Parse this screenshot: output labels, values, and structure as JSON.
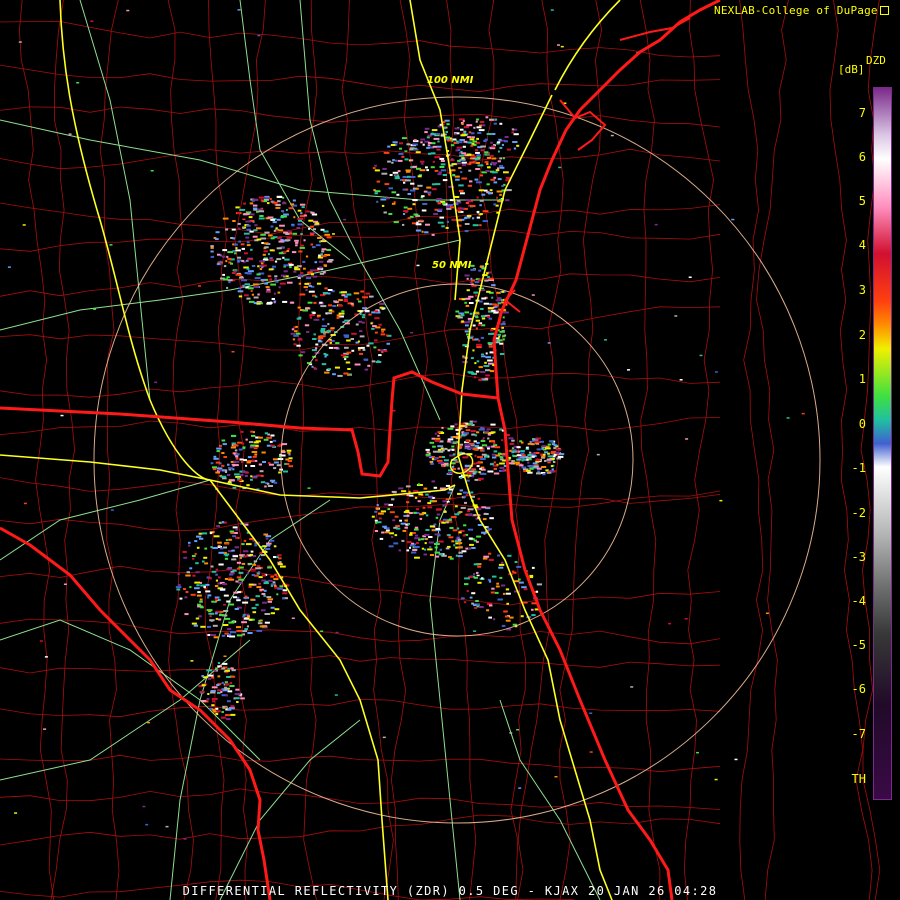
{
  "header": {
    "credit": "NEXLAB-College of DuPage"
  },
  "legend": {
    "product": "DZD",
    "unit": "[dB]",
    "ticks": [
      "7",
      "6",
      "5",
      "4",
      "3",
      "2",
      "1",
      "0",
      "-1",
      "-2",
      "-3",
      "-4",
      "-5",
      "-6",
      "-7",
      "TH"
    ],
    "gradient_stops": [
      {
        "value": 7.5,
        "color": "#7a2a8a"
      },
      {
        "value": 6.5,
        "color": "#dcc8e6"
      },
      {
        "value": 6.0,
        "color": "#ffffff"
      },
      {
        "value": 5.0,
        "color": "#ff8fbf"
      },
      {
        "value": 4.0,
        "color": "#d01030"
      },
      {
        "value": 3.0,
        "color": "#ff4010"
      },
      {
        "value": 2.5,
        "color": "#ff8c00"
      },
      {
        "value": 2.0,
        "color": "#f0f000"
      },
      {
        "value": 1.0,
        "color": "#40e040"
      },
      {
        "value": 0.5,
        "color": "#20c0a0"
      },
      {
        "value": 0.0,
        "color": "#4060d0"
      },
      {
        "value": -0.5,
        "color": "#ffffff"
      },
      {
        "value": -2.0,
        "color": "#b0b0b0"
      },
      {
        "value": -3.0,
        "color": "#707070"
      },
      {
        "value": -4.0,
        "color": "#383838"
      },
      {
        "value": -5.5,
        "color": "#200a28"
      },
      {
        "value": -7.5,
        "color": "#3a0a46"
      }
    ]
  },
  "map": {
    "range_rings": [
      {
        "label": "100 NMI",
        "range_nmi": 100
      },
      {
        "label": "50 NMI",
        "range_nmi": 50
      }
    ],
    "colors": {
      "state_border": "#ff1a1a",
      "county_border": "#b01010",
      "interstate": "#ffff20",
      "highway": "#90e890",
      "range_ring": "#ffc8a0"
    }
  },
  "footer": {
    "title": "DIFFERENTIAL REFLECTIVITY (ZDR) 0.5 DEG - KJAX 20 JAN 26 04:28"
  }
}
